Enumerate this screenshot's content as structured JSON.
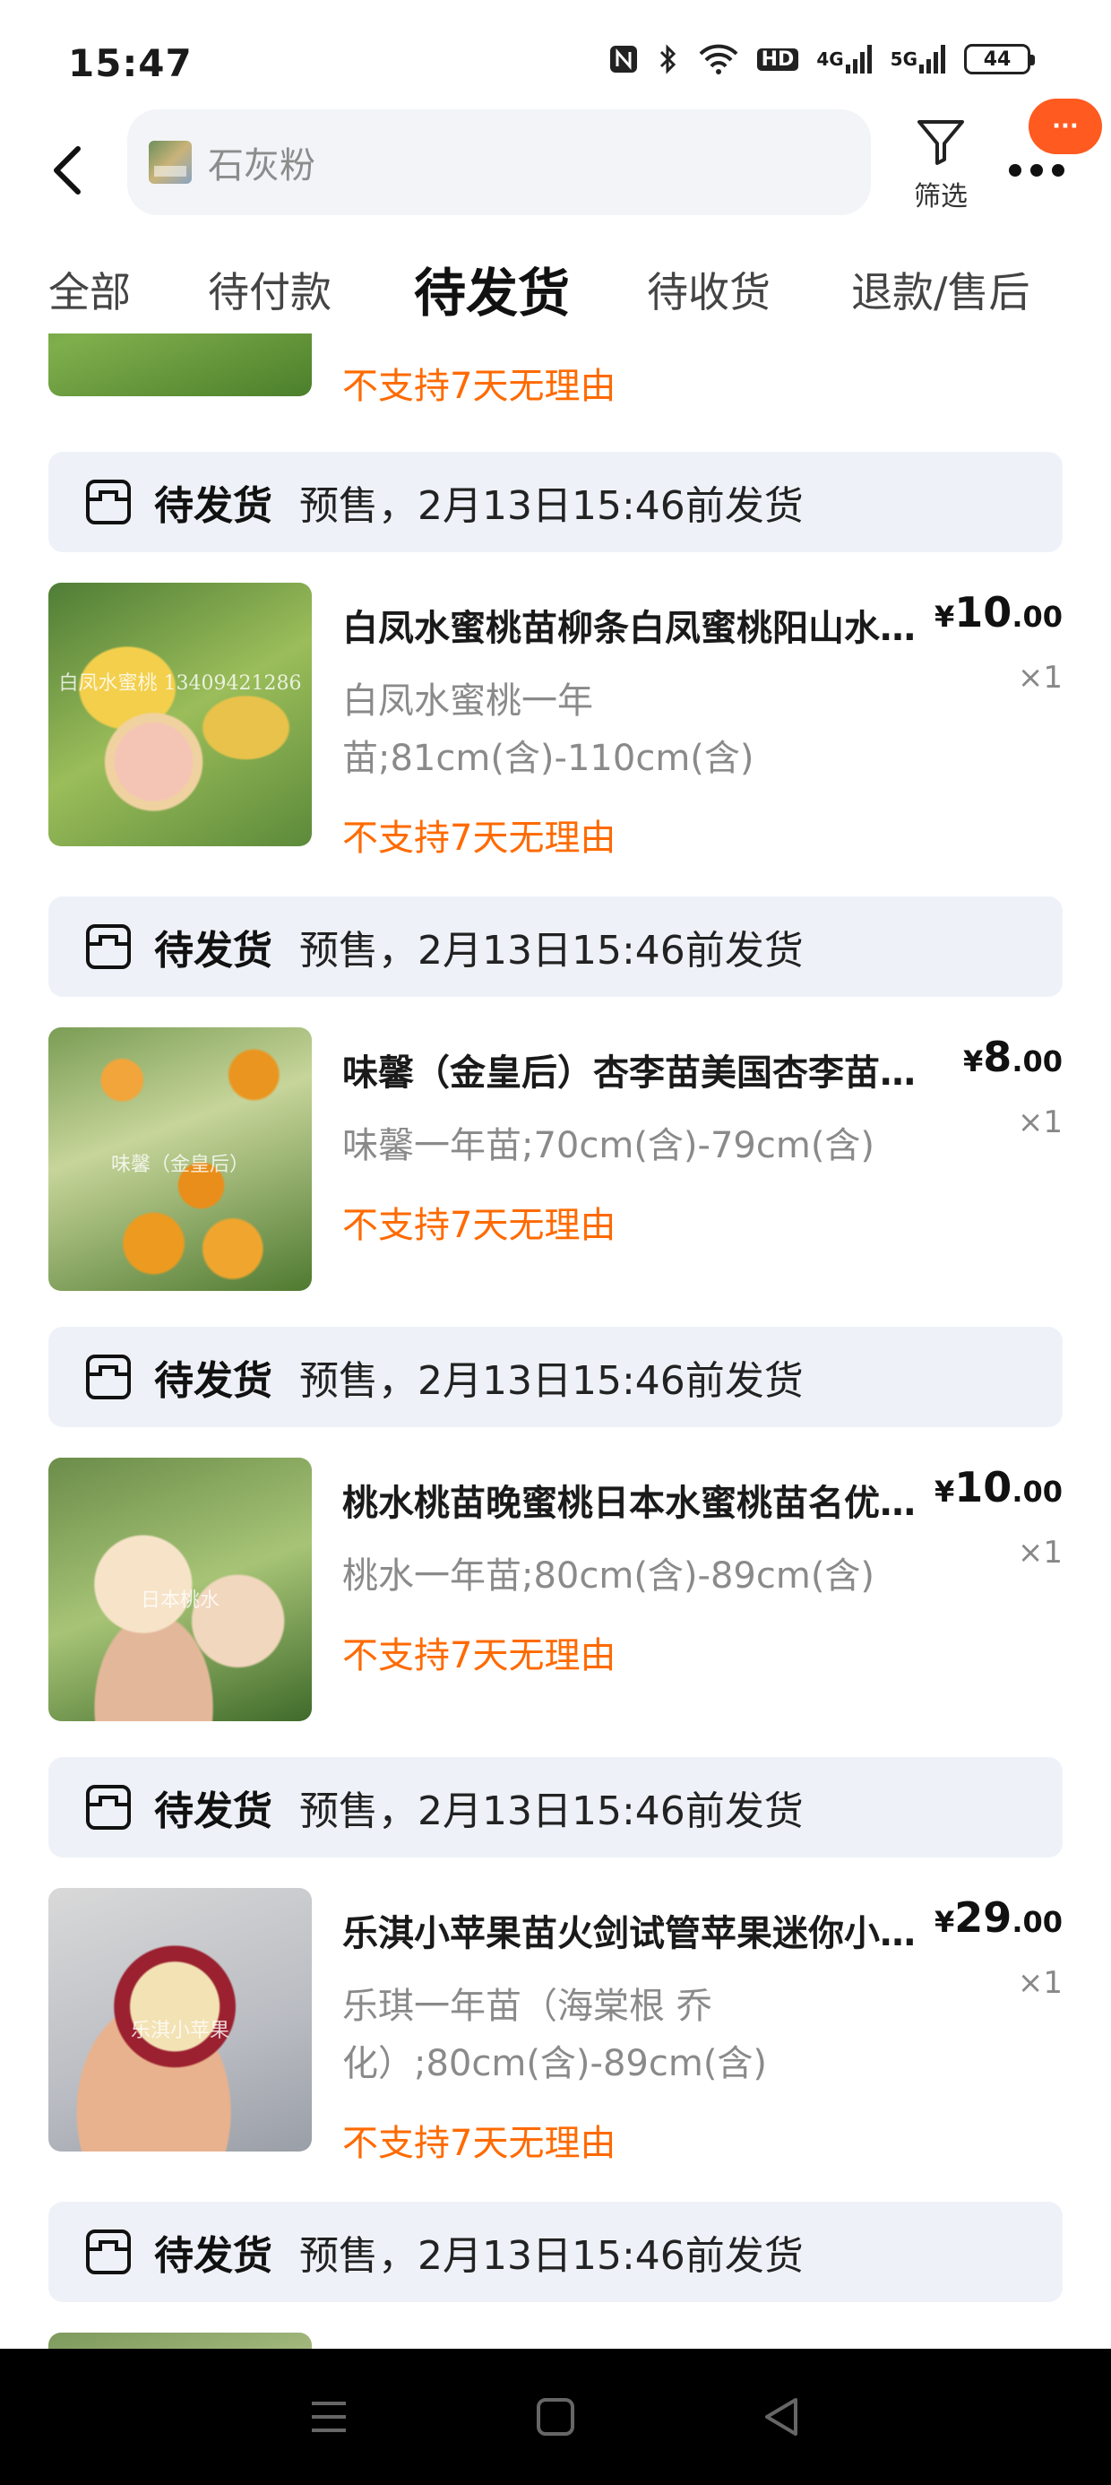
{
  "status_bar": {
    "time": "15:47",
    "battery": "44",
    "network_labels": [
      "HD",
      "4G",
      "5G"
    ]
  },
  "header": {
    "search_placeholder": "石灰粉",
    "filter_label": "筛选",
    "badge_text": "···"
  },
  "tabs": [
    {
      "label": "全部"
    },
    {
      "label": "待付款"
    },
    {
      "label": "待发货"
    },
    {
      "label": "待收货"
    },
    {
      "label": "退款/售后"
    }
  ],
  "active_tab": "待发货",
  "partial_top_item": {
    "policy": "不支持7天无理由"
  },
  "orders": [
    {
      "status": "待发货",
      "ship_note": "预售，2月13日15:46前发货",
      "title": "白凤水蜜桃苗柳条白凤蜜桃阳山水蜜桃苗",
      "spec": "白凤水蜜桃一年苗;81cm(含)-110cm(含)",
      "policy": "不支持7天无理由",
      "price_currency": "¥",
      "price_int": "10",
      "price_dec": ".00",
      "quantity": "×1",
      "thumb_watermark": "白凤水蜜桃 13409421286"
    },
    {
      "status": "待发货",
      "ship_note": "预售，2月13日15:46前发货",
      "title": "味馨（金皇后）杏李苗美国杏李苗嫁接苗",
      "spec": "味馨一年苗;70cm(含)-79cm(含)",
      "policy": "不支持7天无理由",
      "price_currency": "¥",
      "price_int": "8",
      "price_dec": ".00",
      "quantity": "×1",
      "thumb_watermark": "味馨（金皇后）"
    },
    {
      "status": "待发货",
      "ship_note": "预售，2月13日15:46前发货",
      "title": "桃水桃苗晚蜜桃日本水蜜桃苗名优品种",
      "spec": "桃水一年苗;80cm(含)-89cm(含)",
      "policy": "不支持7天无理由",
      "price_currency": "¥",
      "price_int": "10",
      "price_dec": ".00",
      "quantity": "×1",
      "thumb_watermark": "日本桃水"
    },
    {
      "status": "待发货",
      "ship_note": "预售，2月13日15:46前发货",
      "title": "乐淇小苹果苗火剑试管苹果迷你小苹果苗",
      "spec": "乐琪一年苗（海棠根 乔化）;80cm(含)-89cm(含)",
      "policy": "不支持7天无理由",
      "price_currency": "¥",
      "price_int": "29",
      "price_dec": ".00",
      "quantity": "×1",
      "thumb_watermark": "乐淇小苹果"
    }
  ],
  "last_banner": {
    "status": "待发货",
    "ship_note": "预售，2月13日15:46前发货"
  },
  "colors": {
    "accent_orange": "#ff6a00",
    "banner_bg": "#eef2f8",
    "search_bg": "#f2f4f7",
    "badge": "#ff5a1f"
  }
}
